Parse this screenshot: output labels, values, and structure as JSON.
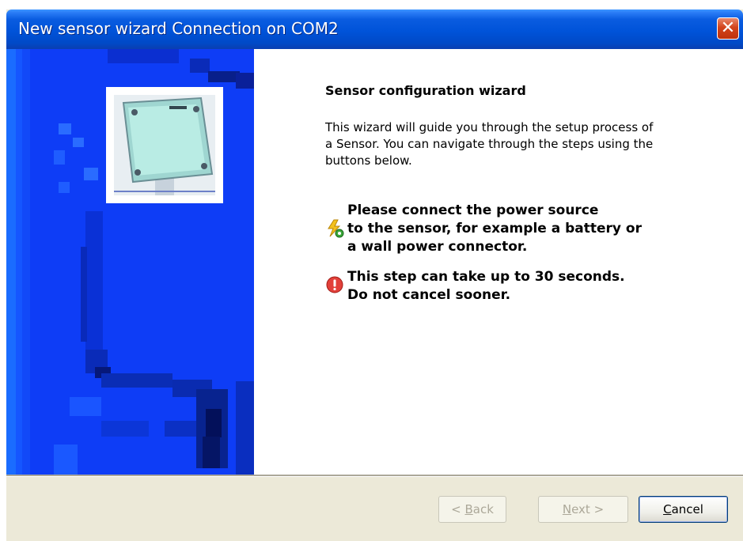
{
  "window": {
    "title": "New sensor wizard Connection on COM2",
    "close_label": "✕"
  },
  "content": {
    "heading": "Sensor configuration wizard",
    "intro": "This wizard will guide you through the setup process of a Sensor. You can navigate through the steps using the buttons below.",
    "power_note": {
      "icon": "power-plug-icon",
      "lines": [
        "Please connect the power source",
        "to the sensor, for example a battery or",
        "a wall power connector."
      ]
    },
    "warning_note": {
      "icon": "error-icon",
      "lines": [
        "This step can take up to 30 seconds.",
        "Do not cancel sooner."
      ]
    }
  },
  "buttons": {
    "back": {
      "prefix": "< ",
      "accel": "B",
      "rest": "ack",
      "enabled": false
    },
    "next": {
      "prefix": "",
      "accel": "N",
      "rest": "ext >",
      "enabled": false
    },
    "cancel": {
      "prefix": "",
      "accel": "C",
      "rest": "ancel",
      "enabled": true
    }
  },
  "colors": {
    "titlebar": "#0053d9",
    "side_panel": "#0e3df6",
    "dialog_face": "#ece9d8"
  }
}
